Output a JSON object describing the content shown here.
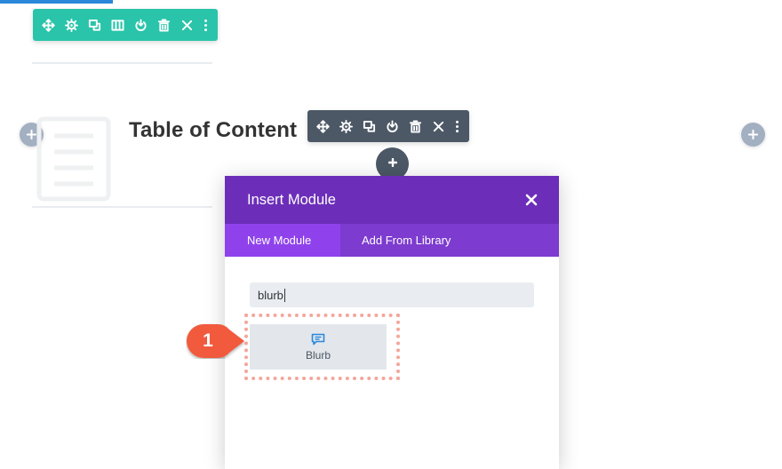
{
  "row_toolbar": {
    "icons": [
      "move-icon",
      "gear-icon",
      "duplicate-icon",
      "columns-icon",
      "power-icon",
      "trash-icon",
      "close-icon",
      "more-icon"
    ]
  },
  "module_toolbar": {
    "icons": [
      "move-icon",
      "gear-icon",
      "duplicate-icon",
      "power-icon",
      "trash-icon",
      "close-icon",
      "more-icon"
    ]
  },
  "module": {
    "title": "Table of Content",
    "icon": "document-icon"
  },
  "modal": {
    "title": "Insert Module",
    "close_icon": "close-icon",
    "tabs": [
      {
        "label": "New Module",
        "active": true
      },
      {
        "label": "Add From Library",
        "active": false
      }
    ],
    "search": {
      "value": "blurb"
    },
    "results": [
      {
        "label": "Blurb",
        "icon": "blurb-icon"
      }
    ]
  },
  "callout": {
    "number": "1"
  },
  "colors": {
    "row_toolbar": "#29c4a9",
    "module_toolbar": "#4c5866",
    "modal_header": "#6c2eb9",
    "modal_tabs": "#7d3bcf",
    "active_tab": "#8f42ec",
    "callout": "#f15a3e",
    "highlight": "#f4a69a"
  }
}
